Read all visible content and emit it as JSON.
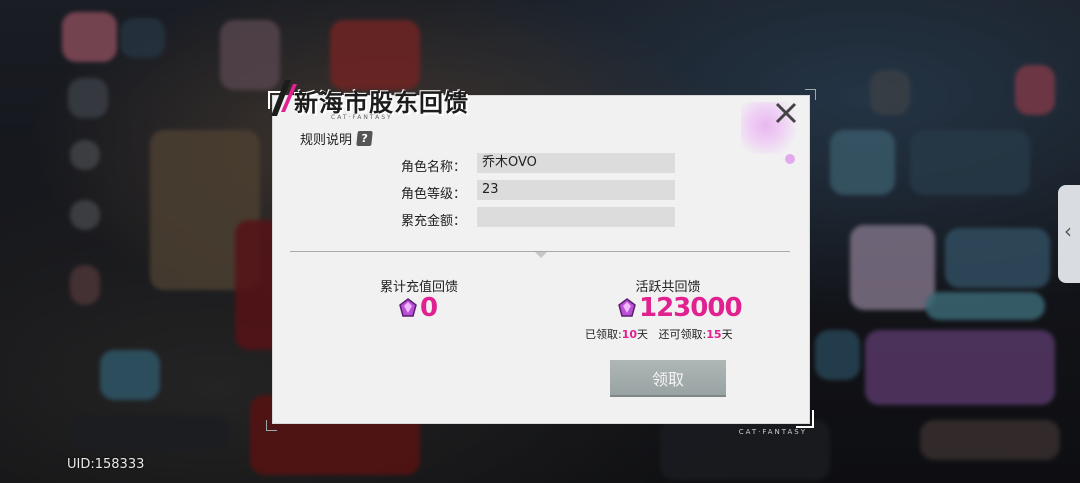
{
  "uid": "UID:158333",
  "side_tab_glyph": "‹",
  "dialog": {
    "title": "新海市股东回馈",
    "subtitle": "CAT·FANTASY",
    "brand": "CAT·FANTASY",
    "rules_label": "规则说明",
    "rules_icon_glyph": "?",
    "fields": [
      {
        "label": "角色名称：",
        "value": "乔木OVO"
      },
      {
        "label": "角色等级：",
        "value": "23"
      },
      {
        "label": "累充金额：",
        "value": ""
      }
    ],
    "recharge": {
      "title": "累计充值回馈",
      "amount": "0"
    },
    "active": {
      "title": "活跃共回馈",
      "amount": "123000",
      "claimed_prefix": "已领取:",
      "claimed_days": "10",
      "claimed_suffix": "天",
      "remain_prefix": "还可领取:",
      "remain_days": "15",
      "remain_suffix": "天"
    },
    "claim_button": "领取"
  },
  "colors": {
    "accent_pink": "#e1218f",
    "dialog_bg": "#f1f1f1",
    "button_grey": "#a3abab"
  },
  "icons": [
    "close-icon",
    "question-icon",
    "gem-icon",
    "side-arrow-icon"
  ]
}
